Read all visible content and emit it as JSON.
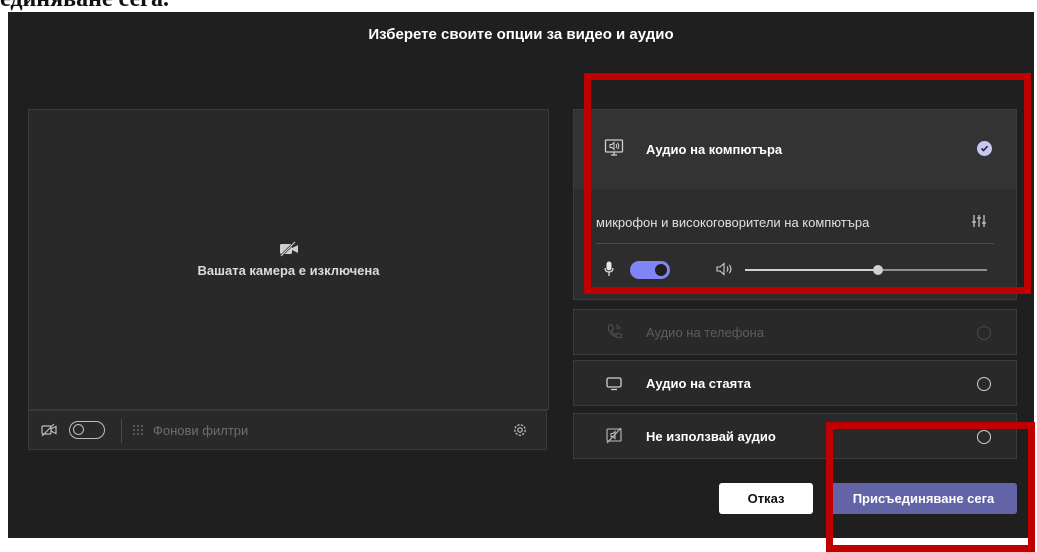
{
  "caption": "единяване сега.",
  "dialog": {
    "title": "Изберете своите опции за видео и аудио"
  },
  "camera": {
    "status_text": "Вашата камера е изключена",
    "toolbar": {
      "background_filters_label": "Фонови филтри"
    }
  },
  "audio_options": {
    "computer_audio": {
      "label": "Аудио на компютъра",
      "device": "микрофон и високоговорители на компютъра",
      "mic_enabled": true,
      "volume_percent": 55
    },
    "phone_audio": {
      "label": "Аудио на телефона"
    },
    "room_audio": {
      "label": "Аудио на стаята"
    },
    "no_audio": {
      "label": "Не използвай аудио"
    }
  },
  "buttons": {
    "cancel_label": "Отказ",
    "join_label": "Присъединяване сега"
  },
  "colors": {
    "accent": "#6264a7",
    "toggle_on": "#7f85f5",
    "highlight": "#c00000",
    "background": "#1f1f1f"
  }
}
